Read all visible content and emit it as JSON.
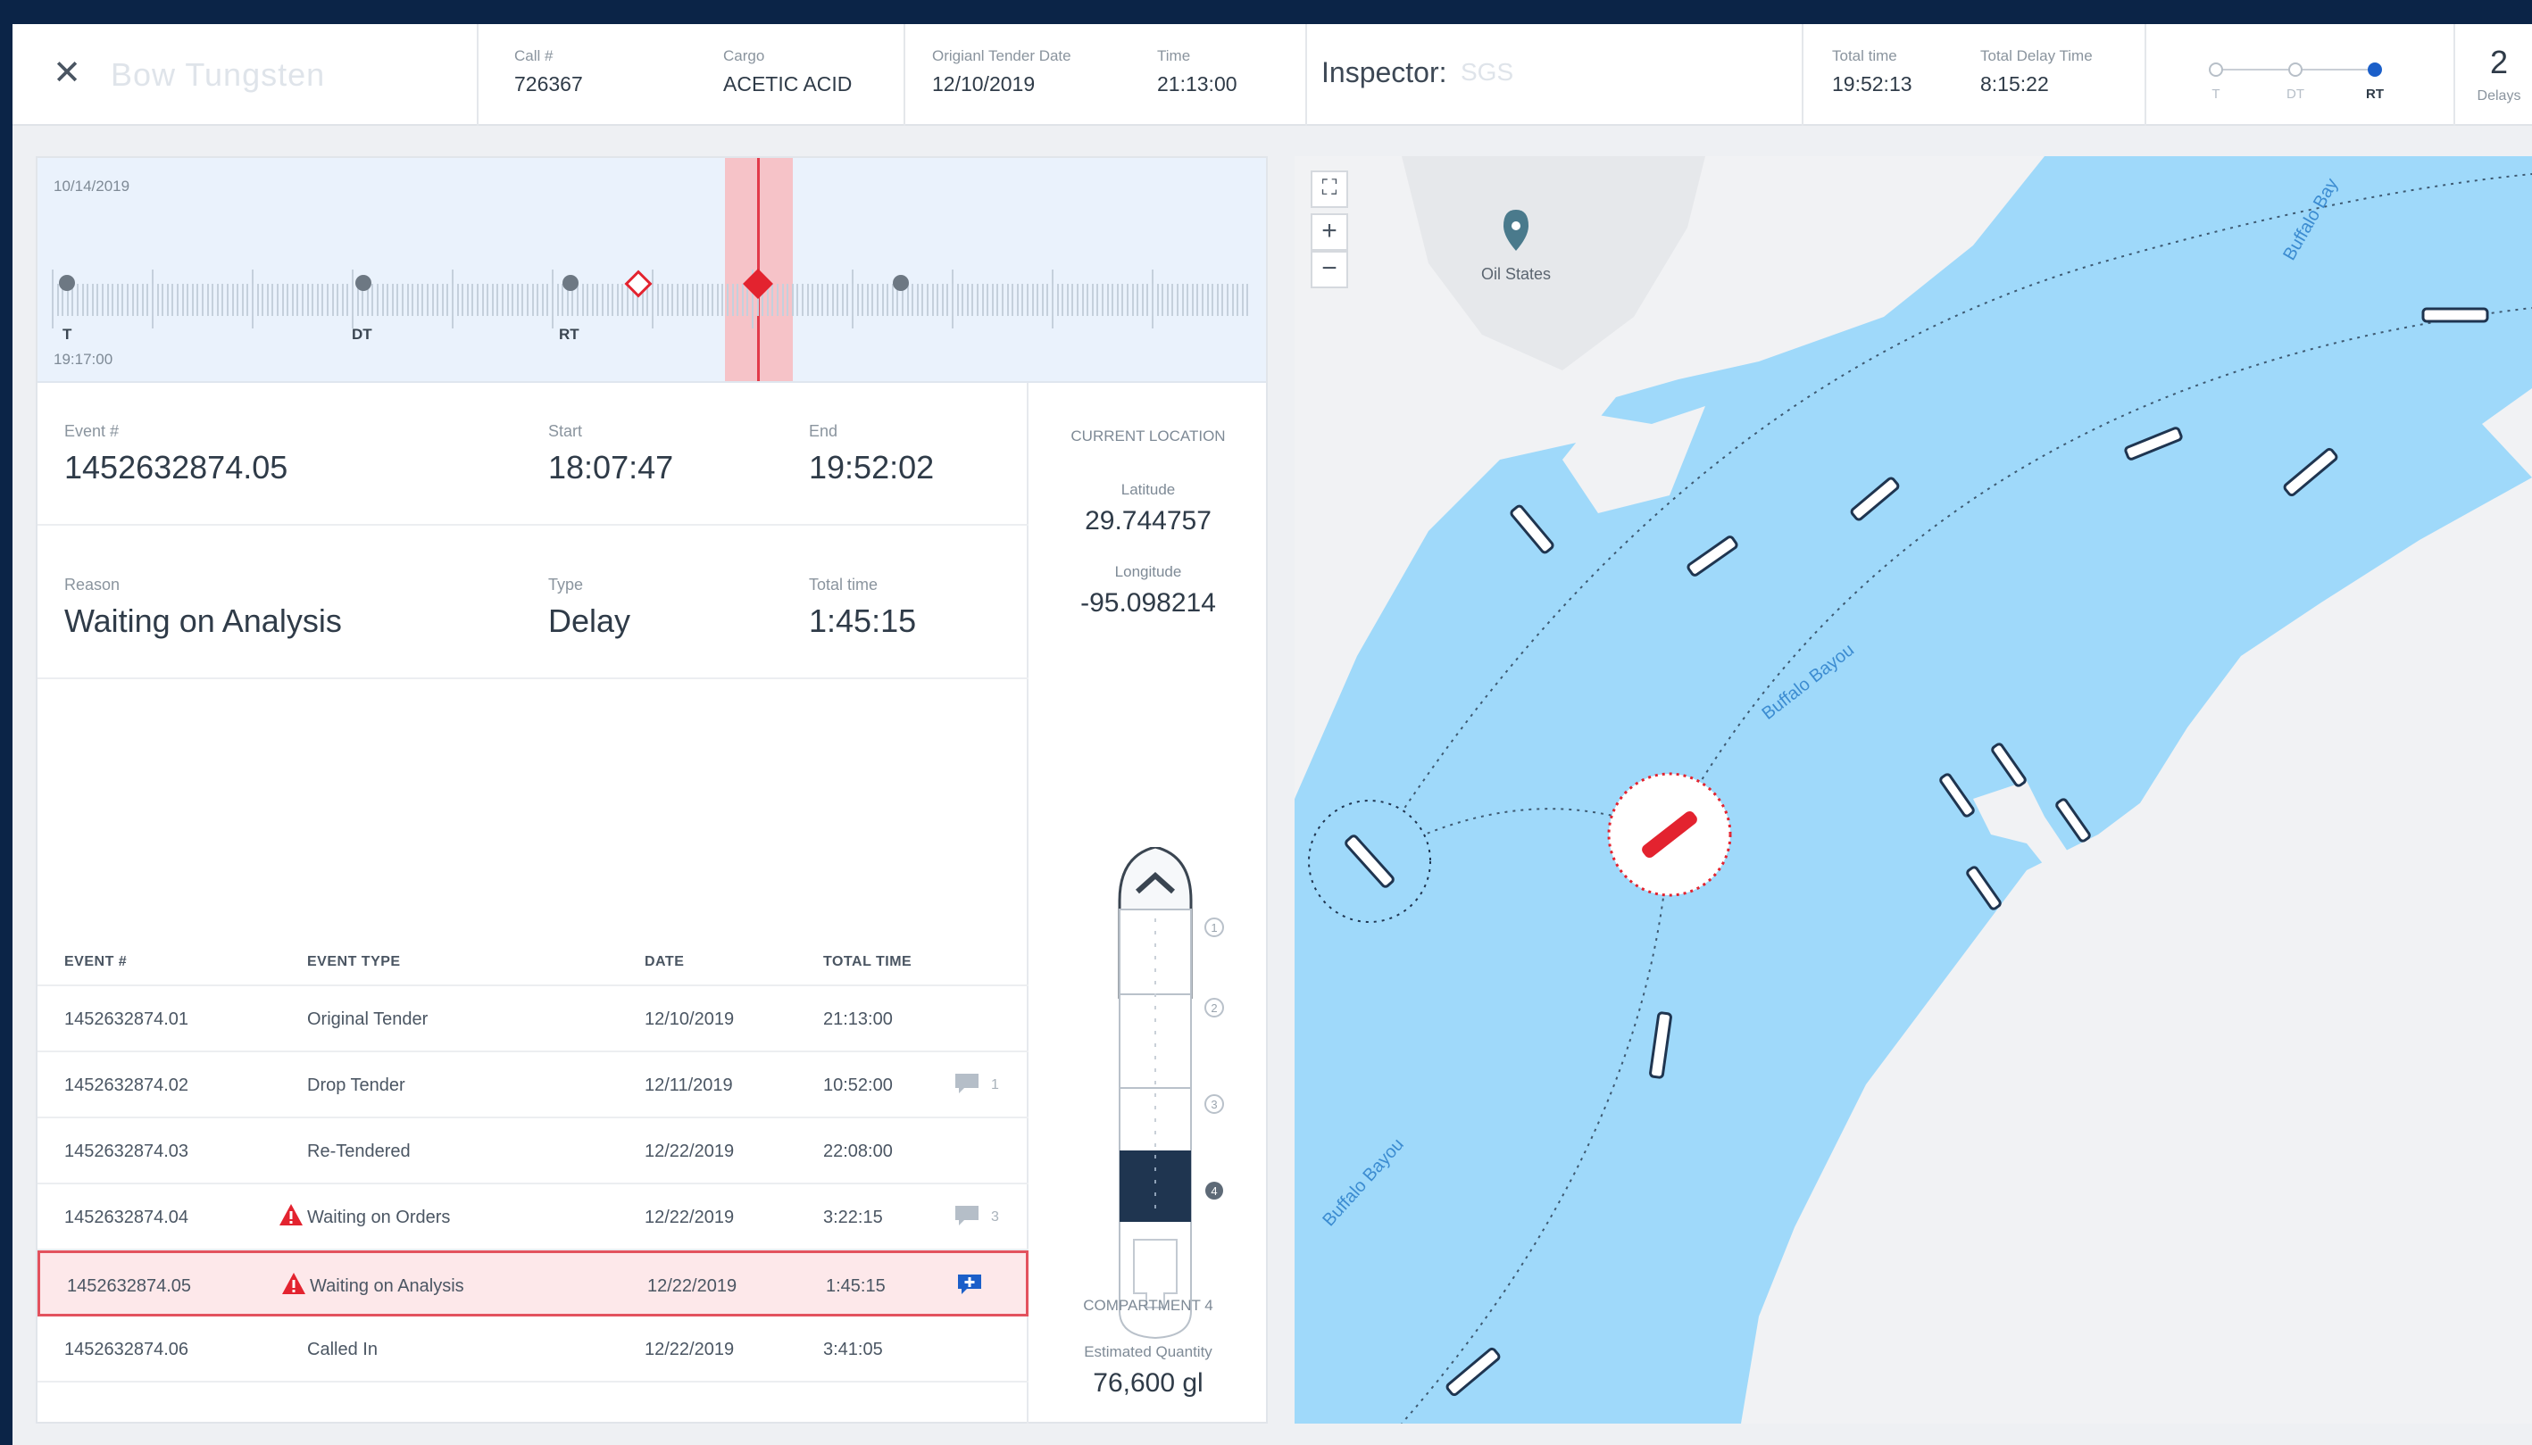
{
  "header": {
    "close_icon": "close-icon",
    "vessel_name": "Bow Tungsten",
    "call_label": "Call #",
    "call_value": "726367",
    "cargo_label": "Cargo",
    "cargo_value": "ACETIC ACID",
    "tender_date_label": "Origianl Tender Date",
    "tender_date_value": "12/10/2019",
    "time_label": "Time",
    "time_value": "21:13:00",
    "inspector_label": "Inspector:",
    "inspector_value": "SGS",
    "total_time_label": "Total time",
    "total_time_value": "19:52:13",
    "total_delay_label": "Total Delay Time",
    "total_delay_value": "8:15:22",
    "stepper": [
      {
        "label": "T",
        "active": false
      },
      {
        "label": "DT",
        "active": false
      },
      {
        "label": "RT",
        "active": true
      }
    ],
    "delays_count": "2",
    "delays_label": "Delays"
  },
  "timeline": {
    "date": "10/14/2019",
    "start_time": "19:17:00",
    "markers": [
      {
        "label": "T"
      },
      {
        "label": "DT"
      },
      {
        "label": "RT"
      }
    ]
  },
  "event": {
    "event_label": "Event #",
    "event_value": "1452632874.05",
    "start_label": "Start",
    "start_value": "18:07:47",
    "end_label": "End",
    "end_value": "19:52:02",
    "reason_label": "Reason",
    "reason_value": "Waiting on Analysis",
    "type_label": "Type",
    "type_value": "Delay",
    "total_label": "Total time",
    "total_value": "1:45:15"
  },
  "table": {
    "headers": [
      "EVENT #",
      "EVENT TYPE",
      "DATE",
      "TOTAL TIME"
    ],
    "rows": [
      {
        "id": "1452632874.01",
        "type": "Original Tender",
        "date": "12/10/2019",
        "total": "21:13:00",
        "warning": false,
        "comments": ""
      },
      {
        "id": "1452632874.02",
        "type": "Drop Tender",
        "date": "12/11/2019",
        "total": "10:52:00",
        "warning": false,
        "comments": "1"
      },
      {
        "id": "1452632874.03",
        "type": "Re-Tendered",
        "date": "12/22/2019",
        "total": "22:08:00",
        "warning": false,
        "comments": ""
      },
      {
        "id": "1452632874.04",
        "type": "Waiting on Orders",
        "date": "12/22/2019",
        "total": "3:22:15",
        "warning": true,
        "comments": "3"
      },
      {
        "id": "1452632874.05",
        "type": "Waiting on Analysis",
        "date": "12/22/2019",
        "total": "1:45:15",
        "warning": true,
        "comments": "add"
      },
      {
        "id": "1452632874.06",
        "type": "Called In",
        "date": "12/22/2019",
        "total": "3:41:05",
        "warning": false,
        "comments": ""
      }
    ],
    "selected_row": 4
  },
  "location": {
    "title": "CURRENT LOCATION",
    "lat_label": "Latitude",
    "lat_value": "29.744757",
    "lon_label": "Longitude",
    "lon_value": "-95.098214",
    "compartments": [
      "1",
      "2",
      "3",
      "4"
    ],
    "active_compartment": "4",
    "compartment_label": "COMPARTMENT 4",
    "quantity_label": "Estimated Quantity",
    "quantity_value": "76,600 gl"
  },
  "map": {
    "poi_label": "Oil States",
    "water_labels": [
      "Buffalo Bayou",
      "Buffalo Bayou",
      "Buffalo Bay"
    ],
    "controls": {
      "fullscreen": "fullscreen-icon",
      "zoom_in": "+",
      "zoom_out": "−"
    },
    "colors": {
      "water": "#9fd9fa",
      "land": "#f1f2f4",
      "accent": "#e3232f",
      "selected": "#1b5fc9"
    }
  }
}
